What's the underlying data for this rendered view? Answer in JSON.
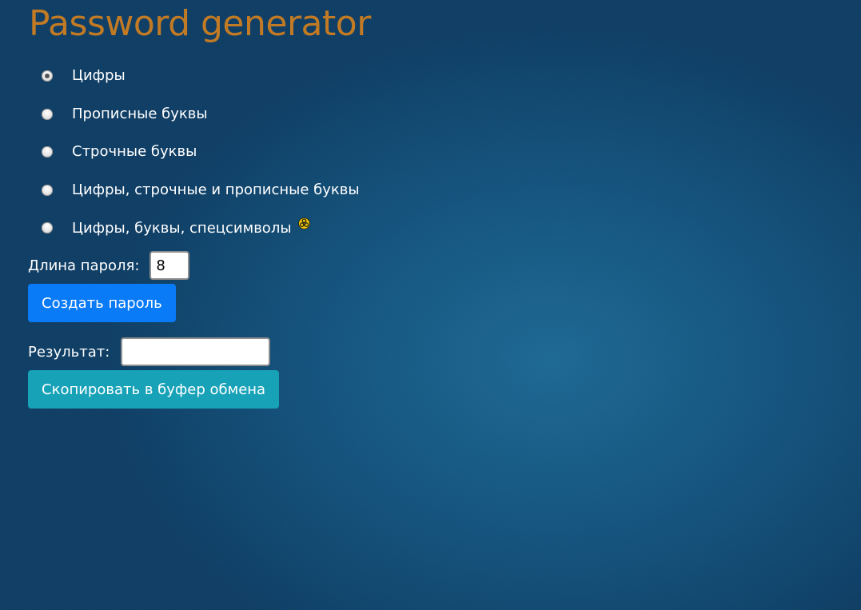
{
  "header": {
    "title": "Password generator"
  },
  "options": [
    {
      "label": "Цифры",
      "checked": true
    },
    {
      "label": "Прописные буквы",
      "checked": false
    },
    {
      "label": "Строчные буквы",
      "checked": false
    },
    {
      "label": "Цифры, строчные и прописные буквы",
      "checked": false
    },
    {
      "label": "Цифры, буквы, спецсимволы",
      "checked": false,
      "icon": "biohazard-icon"
    }
  ],
  "length": {
    "label": "Длина пароля:",
    "value": "8"
  },
  "generate_button": {
    "label": "Создать пароль"
  },
  "result": {
    "label": "Результат:",
    "value": ""
  },
  "copy_button": {
    "label": "Скопировать в буфер обмена"
  },
  "colors": {
    "title": "#c27b24",
    "primary_button": "#0a7bf7",
    "info_button": "#17a2b8",
    "background": "#154f78"
  }
}
